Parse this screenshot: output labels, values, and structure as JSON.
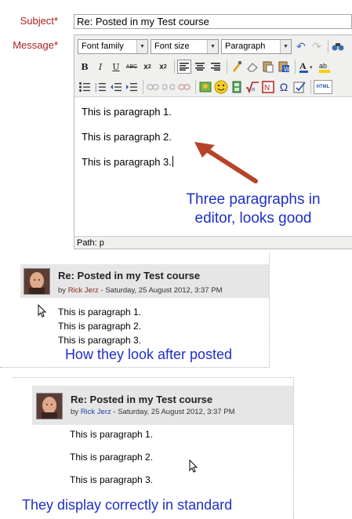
{
  "form": {
    "subject_label": "Subject",
    "message_label": "Message",
    "required_marker": "*",
    "subject_value": "Re: Posted in my Test course"
  },
  "editor": {
    "font_family": "Font family",
    "font_size": "Font size",
    "format": "Paragraph",
    "paragraphs": [
      "This is paragraph 1.",
      "This is paragraph 2.",
      "This is paragraph 3."
    ],
    "path": "Path: p",
    "html_button": "HTML",
    "toolbar_icons": [
      "bold-icon",
      "italic-icon",
      "underline-icon",
      "strikethrough-icon",
      "subscript-icon",
      "superscript-icon",
      "align-left-icon",
      "align-center-icon",
      "align-right-icon",
      "paint-icon",
      "eraser-icon",
      "paste-icon",
      "paste-word-icon",
      "font-color-icon",
      "highlight-icon",
      "bullet-list-icon",
      "numbered-list-icon",
      "outdent-icon",
      "indent-icon",
      "link-icon",
      "unlink-icon",
      "anchor-icon",
      "image-icon",
      "emoticon-icon",
      "media-icon",
      "equation-icon",
      "nonbreaking-icon",
      "special-char-icon",
      "spellcheck-icon",
      "html-icon",
      "undo-icon",
      "redo-icon",
      "find-icon"
    ]
  },
  "annotations": {
    "editor_line1": "Three paragraphs in",
    "editor_line2": "editor, looks good",
    "posted": "How they look after posted",
    "standard": "They display correctly in standard",
    "accent_color": "#1f2fc6",
    "arrow_color": "#b5442a"
  },
  "post1": {
    "title": "Re: Posted in my Test course",
    "by_prefix": "by",
    "author": "Rick Jerz",
    "date": "- Saturday, 25 August 2012, 3:37 PM",
    "lines": [
      "This is paragraph 1.",
      "This is paragraph 2.",
      "This is paragraph 3."
    ]
  },
  "post2": {
    "title": "Re: Posted in my Test course",
    "by_prefix": "by",
    "author": "Rick Jerz",
    "date": "- Saturday, 25 August 2012, 3:37 PM",
    "lines": [
      "This is paragraph 1.",
      "This is paragraph 2.",
      "This is paragraph 3."
    ]
  }
}
